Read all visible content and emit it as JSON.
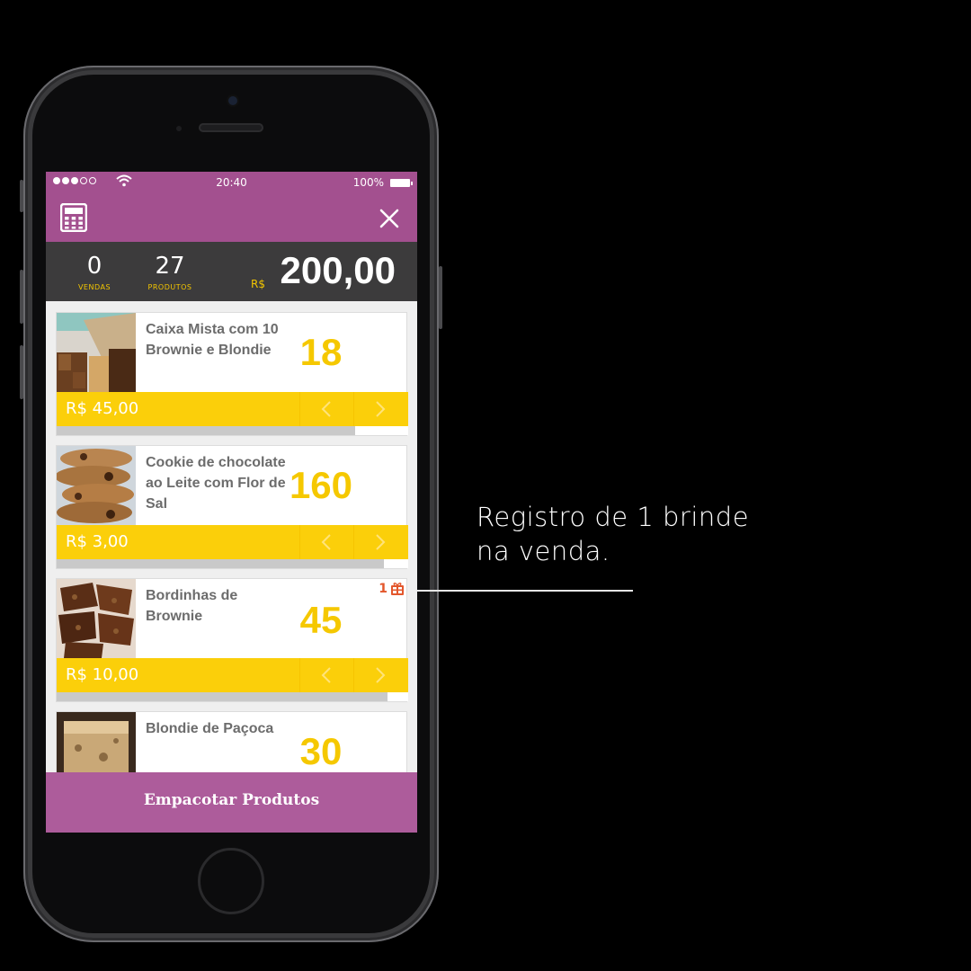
{
  "status_bar": {
    "signal_bars_filled": 3,
    "signal_bars_total": 5,
    "time": "20:40",
    "battery_percent": "100%"
  },
  "app_bar": {
    "left_icon": "calculator-icon",
    "right_icon": "close-icon",
    "background_color": "#a3508f"
  },
  "summary": {
    "vendas_value": "0",
    "vendas_label": "VENDAS",
    "produtos_value": "27",
    "produtos_label": "PRODUTOS",
    "currency": "R$",
    "total": "200,00"
  },
  "products": [
    {
      "name": "Caixa Mista com 10 Brownie e Blondie",
      "qty": "18",
      "price": "R$ 45,00",
      "progress": 0.85,
      "gift": null
    },
    {
      "name": "Cookie de chocolate ao Leite com Flor de Sal",
      "qty": "160",
      "price": "R$ 3,00",
      "progress": 0.93,
      "gift": null
    },
    {
      "name": "Bordinhas de Brownie",
      "qty": "45",
      "price": "R$ 10,00",
      "progress": 0.94,
      "gift": "1"
    },
    {
      "name": "Blondie de Paçoca",
      "qty": "30",
      "price": "",
      "progress": 0,
      "gift": null
    }
  ],
  "footer": {
    "label": "Empacotar Produtos"
  },
  "annotation": {
    "line1": "Registro de 1 brinde",
    "line2": "na venda."
  },
  "colors": {
    "accent_purple": "#a3508f",
    "accent_yellow": "#fbcf0a",
    "qty_yellow": "#f5c800",
    "gift_orange": "#e3572c"
  }
}
